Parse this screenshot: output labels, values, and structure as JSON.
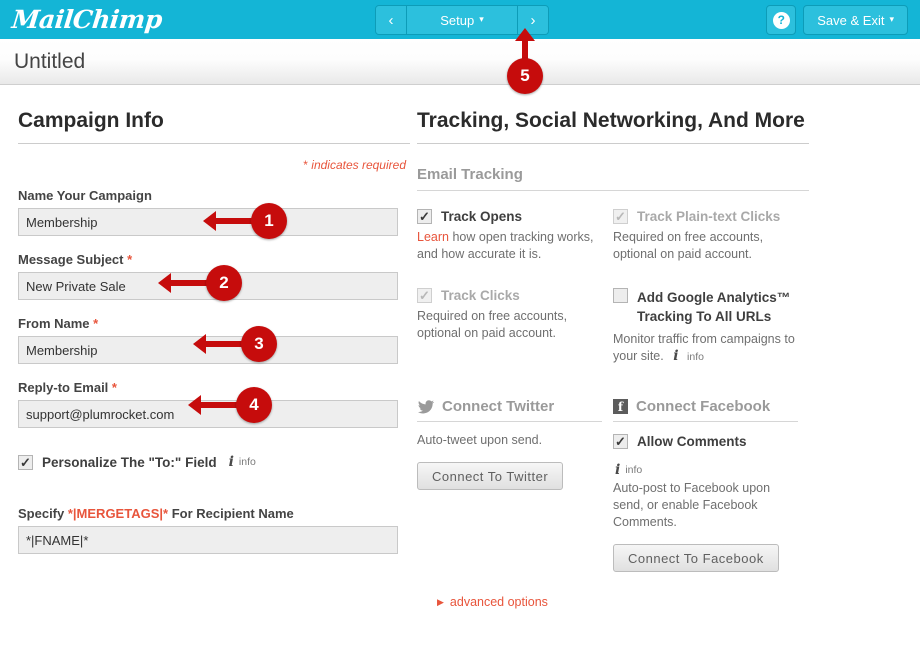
{
  "topbar": {
    "logo": "MailChimp",
    "nav_prev": "‹",
    "nav_setup": "Setup",
    "nav_caret": "▾",
    "nav_next": "›",
    "help_icon": "?",
    "save_exit": "Save & Exit",
    "save_caret": "▾",
    "teal": "#14b5d6"
  },
  "subheader": {
    "title": "Untitled"
  },
  "left": {
    "heading": "Campaign Info",
    "required_note_star": "*",
    "required_note": " indicates required",
    "fields": [
      {
        "label": "Name Your Campaign",
        "required": false,
        "value": "Membership"
      },
      {
        "label": "Message Subject",
        "required": true,
        "value": "New Private Sale"
      },
      {
        "label": "From Name",
        "required": true,
        "value": "Membership"
      },
      {
        "label": "Reply-to Email",
        "required": true,
        "value": "support@plumrocket.com"
      }
    ],
    "personalize": {
      "label": "Personalize The \"To:\" Field",
      "checked": true,
      "info_label": "info"
    },
    "mergetag_label_before": "Specify ",
    "mergetag_label_tag": "*|MERGETAGS|*",
    "mergetag_label_after": " For Recipient Name",
    "mergetag_value": "*|FNAME|*"
  },
  "right": {
    "heading": "Tracking, Social Networking, And More",
    "email_tracking_label": "Email Tracking",
    "tracking": [
      {
        "label": "Track Opens",
        "checked": true,
        "disabled": false,
        "link": "Learn",
        "help": " how open tracking works, and how accurate it is."
      },
      {
        "label": "Track Plain-text Clicks",
        "checked": true,
        "disabled": true,
        "link": "",
        "help": "Required on free accounts, optional on paid account."
      },
      {
        "label": "Track Clicks",
        "checked": true,
        "disabled": true,
        "link": "",
        "help": "Required on free accounts, optional on paid account."
      },
      {
        "label": "Add Google Analytics™ Tracking To All URLs",
        "checked": false,
        "disabled": false,
        "link": "",
        "help": "Monitor traffic from campaigns to your site.",
        "info_label": "info"
      }
    ],
    "twitter": {
      "icon": "twitter-bird-icon",
      "heading": "Connect Twitter",
      "help": "Auto-tweet upon send.",
      "button": "Connect To Twitter"
    },
    "facebook": {
      "icon": "facebook-icon",
      "icon_glyph": "f",
      "heading": "Connect Facebook",
      "allow_comments_label": "Allow Comments",
      "allow_comments_checked": true,
      "info_label": "info",
      "help": "Auto-post to Facebook upon send, or enable Facebook Comments.",
      "button": "Connect To Facebook"
    },
    "advanced_options": "advanced options",
    "advanced_triangle": "▶"
  },
  "callouts": [
    {
      "number": "1"
    },
    {
      "number": "2"
    },
    {
      "number": "3"
    },
    {
      "number": "4"
    },
    {
      "number": "5"
    }
  ],
  "colors": {
    "accent_red": "#c60c0c",
    "link_orange": "#e8553c",
    "teal": "#14b5d6"
  }
}
